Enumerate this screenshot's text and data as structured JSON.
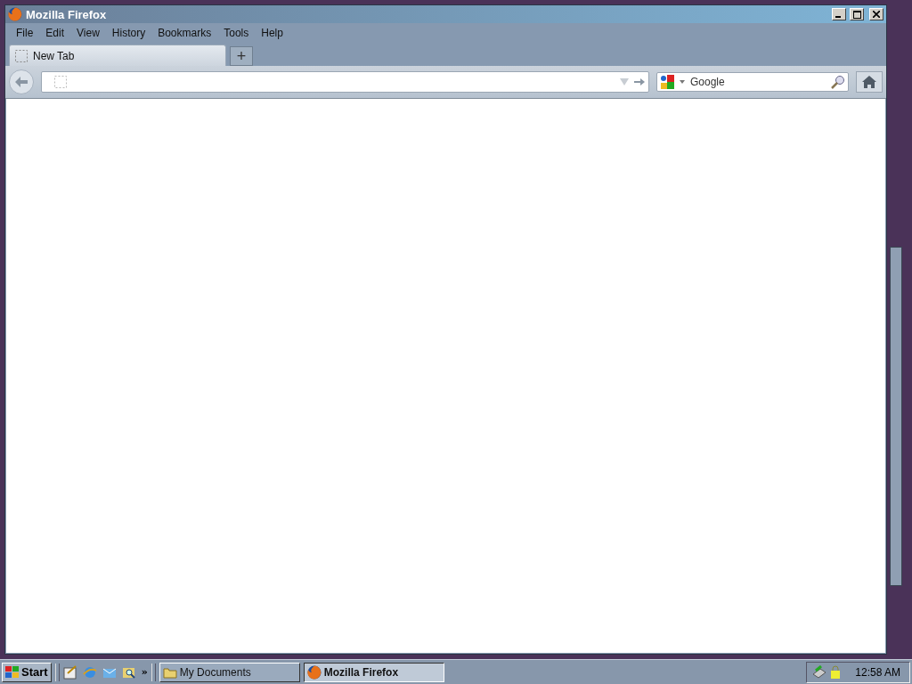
{
  "window": {
    "title": "Mozilla Firefox"
  },
  "menu": [
    "File",
    "Edit",
    "View",
    "History",
    "Bookmarks",
    "Tools",
    "Help"
  ],
  "tabs": [
    {
      "label": "New Tab",
      "selected": true
    }
  ],
  "new_tab": "+",
  "search": {
    "placeholder": "Google"
  },
  "taskbar": {
    "start": "Start",
    "more": "»",
    "tasks": [
      {
        "label": "My Documents",
        "kind": "folder",
        "selected": false
      },
      {
        "label": "Mozilla Firefox",
        "kind": "firefox",
        "selected": true
      }
    ],
    "clock": "12:58 AM"
  }
}
